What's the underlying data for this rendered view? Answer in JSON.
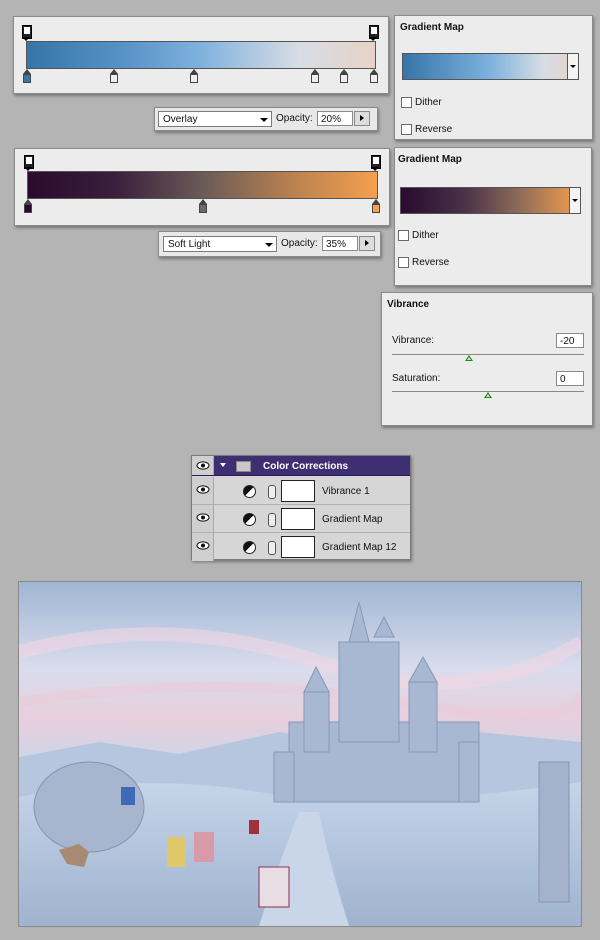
{
  "gradient_map_1": {
    "title": "Gradient Map",
    "dither_label": "Dither",
    "reverse_label": "Reverse",
    "colors": [
      "#3575a8",
      "#7fb2de",
      "#d7dce4",
      "#e7d2c8"
    ],
    "blend_mode": "Overlay",
    "opacity_label": "Opacity:",
    "opacity_value": "20%"
  },
  "gradient_map_2": {
    "title": "Gradient Map",
    "dither_label": "Dither",
    "reverse_label": "Reverse",
    "colors": [
      "#2a0a2e",
      "#6a5a58",
      "#f4a04e"
    ],
    "blend_mode": "Soft Light",
    "opacity_label": "Opacity:",
    "opacity_value": "35%"
  },
  "vibrance": {
    "title": "Vibrance",
    "vibrance_label": "Vibrance:",
    "vibrance_value": "-20",
    "vibrance_level_fraction": 0.4,
    "saturation_label": "Saturation:",
    "saturation_value": "0",
    "saturation_level_fraction": 0.5
  },
  "layers": {
    "group_name": "Color Corrections",
    "items": [
      {
        "name": "Vibrance 1"
      },
      {
        "name": "Gradient Map"
      },
      {
        "name": "Gradient Map 12"
      }
    ]
  },
  "colors": {
    "group_header": "#3d2f72",
    "thumb_green": "#1a8a1a"
  },
  "icons": [
    "eye-icon",
    "folder-icon",
    "chevron-down-icon",
    "adjustment-icon",
    "chain-icon",
    "triangle-right-icon"
  ]
}
